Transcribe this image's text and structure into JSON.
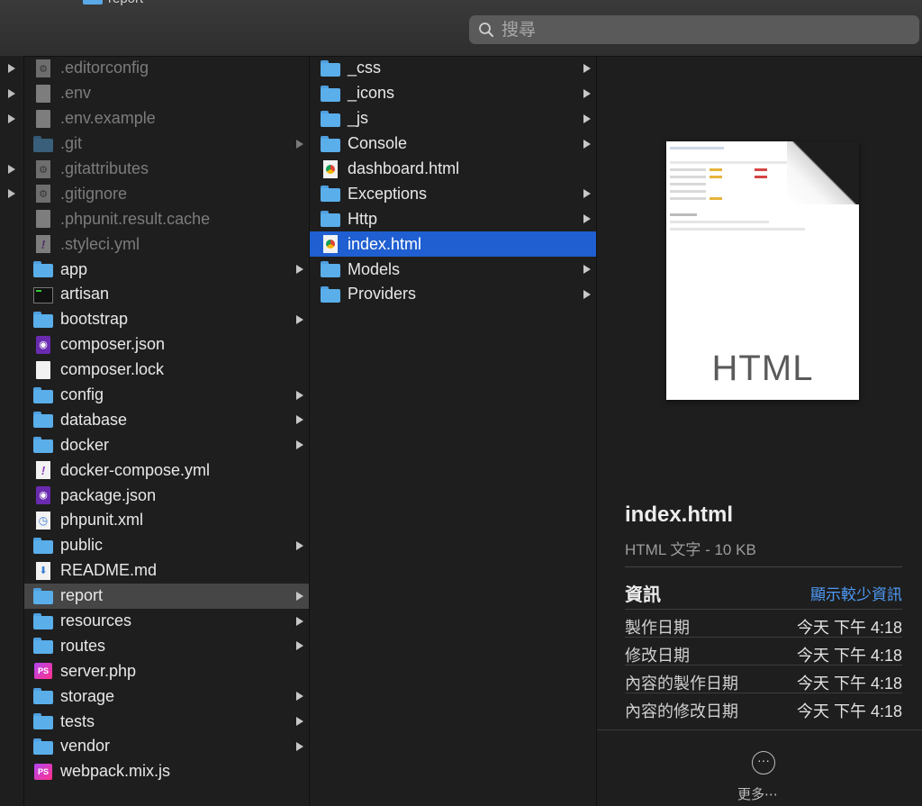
{
  "toolbar": {
    "breadcrumb": "report",
    "search_placeholder": "搜尋"
  },
  "column1": {
    "items": [
      {
        "name": ".editorconfig",
        "icon": "config-file-icon",
        "folder": false,
        "dim": true
      },
      {
        "name": ".env",
        "icon": "document-icon",
        "folder": false,
        "dim": true
      },
      {
        "name": ".env.example",
        "icon": "document-icon",
        "folder": false,
        "dim": true
      },
      {
        "name": ".git",
        "icon": "folder-icon",
        "folder": true,
        "dim": true
      },
      {
        "name": ".gitattributes",
        "icon": "config-file-icon",
        "folder": false,
        "dim": true
      },
      {
        "name": ".gitignore",
        "icon": "config-file-icon",
        "folder": false,
        "dim": true
      },
      {
        "name": ".phpunit.result.cache",
        "icon": "document-icon",
        "folder": false,
        "dim": true
      },
      {
        "name": ".styleci.yml",
        "icon": "yml-file-icon",
        "folder": false,
        "dim": true
      },
      {
        "name": "app",
        "icon": "folder-icon",
        "folder": true
      },
      {
        "name": "artisan",
        "icon": "terminal-icon",
        "folder": false
      },
      {
        "name": "bootstrap",
        "icon": "folder-icon",
        "folder": true
      },
      {
        "name": "composer.json",
        "icon": "json-file-icon",
        "folder": false
      },
      {
        "name": "composer.lock",
        "icon": "document-icon",
        "folder": false
      },
      {
        "name": "config",
        "icon": "folder-icon",
        "folder": true
      },
      {
        "name": "database",
        "icon": "folder-icon",
        "folder": true
      },
      {
        "name": "docker",
        "icon": "folder-icon",
        "folder": true
      },
      {
        "name": "docker-compose.yml",
        "icon": "yml-file-icon",
        "folder": false
      },
      {
        "name": "package.json",
        "icon": "json-file-icon",
        "folder": false
      },
      {
        "name": "phpunit.xml",
        "icon": "xml-file-icon",
        "folder": false
      },
      {
        "name": "public",
        "icon": "folder-icon",
        "folder": true
      },
      {
        "name": "README.md",
        "icon": "markdown-file-icon",
        "folder": false
      },
      {
        "name": "report",
        "icon": "folder-icon",
        "folder": true,
        "selected": true
      },
      {
        "name": "resources",
        "icon": "folder-icon",
        "folder": true
      },
      {
        "name": "routes",
        "icon": "folder-icon",
        "folder": true
      },
      {
        "name": "server.php",
        "icon": "phpstorm-file-icon",
        "folder": false
      },
      {
        "name": "storage",
        "icon": "folder-icon",
        "folder": true
      },
      {
        "name": "tests",
        "icon": "folder-icon",
        "folder": true
      },
      {
        "name": "vendor",
        "icon": "folder-icon",
        "folder": true
      },
      {
        "name": "webpack.mix.js",
        "icon": "phpstorm-file-icon",
        "folder": false
      }
    ]
  },
  "column2": {
    "items": [
      {
        "name": "_css",
        "icon": "folder-icon",
        "folder": true
      },
      {
        "name": "_icons",
        "icon": "folder-icon",
        "folder": true
      },
      {
        "name": "_js",
        "icon": "folder-icon",
        "folder": true
      },
      {
        "name": "Console",
        "icon": "folder-icon",
        "folder": true
      },
      {
        "name": "dashboard.html",
        "icon": "html-file-icon",
        "folder": false
      },
      {
        "name": "Exceptions",
        "icon": "folder-icon",
        "folder": true
      },
      {
        "name": "Http",
        "icon": "folder-icon",
        "folder": true
      },
      {
        "name": "index.html",
        "icon": "html-file-icon",
        "folder": false,
        "selected": true
      },
      {
        "name": "Models",
        "icon": "folder-icon",
        "folder": true
      },
      {
        "name": "Providers",
        "icon": "folder-icon",
        "folder": true
      }
    ]
  },
  "preview": {
    "doc_type": "HTML",
    "file_name": "index.html",
    "file_kind": "HTML 文字 - 10 KB",
    "info_title": "資訊",
    "info_toggle": "顯示較少資訊",
    "info": [
      {
        "key": "製作日期",
        "value": "今天 下午 4:18"
      },
      {
        "key": "修改日期",
        "value": "今天 下午 4:18"
      },
      {
        "key": "內容的製作日期",
        "value": "今天 下午 4:18"
      },
      {
        "key": "內容的修改日期",
        "value": "今天 下午 4:18"
      }
    ],
    "more_label": "更多⋯"
  }
}
